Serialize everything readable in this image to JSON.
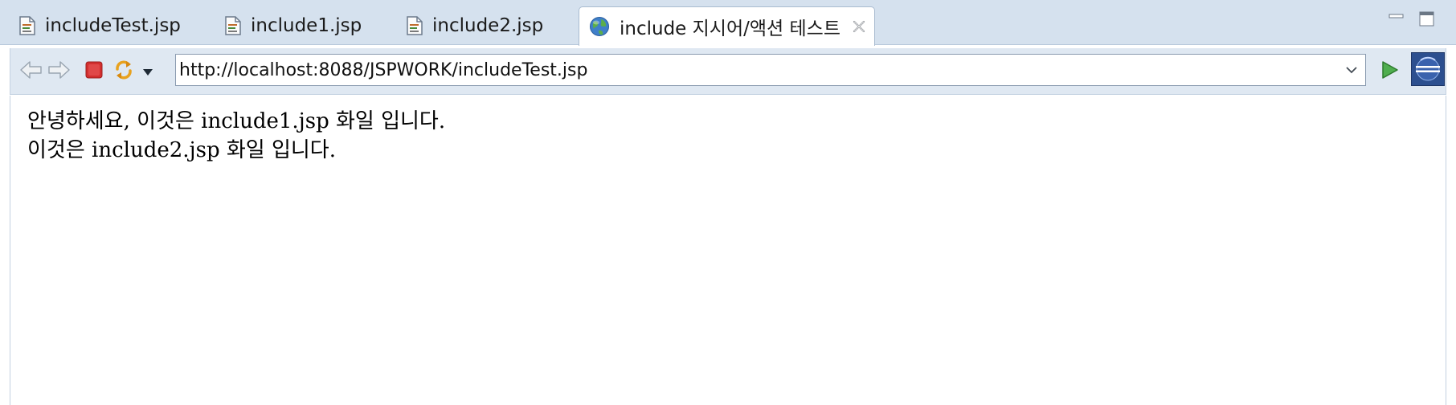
{
  "tabs": [
    {
      "label": "includeTest.jsp",
      "icon": "jsp-file-icon"
    },
    {
      "label": "include1.jsp",
      "icon": "jsp-file-icon"
    },
    {
      "label": "include2.jsp",
      "icon": "jsp-file-icon"
    },
    {
      "label": "include 지시어/액션 테스트",
      "icon": "globe-icon",
      "active": true
    }
  ],
  "window_controls": {
    "minimize_icon": "minimize-icon",
    "maximize_icon": "maximize-icon"
  },
  "toolbar": {
    "back_icon": "back-arrow-icon",
    "forward_icon": "forward-arrow-icon",
    "stop_icon": "stop-icon",
    "refresh_icon": "refresh-icon",
    "refresh_menu_icon": "chevron-down-icon",
    "go_icon": "play-go-icon",
    "browser_icon": "eclipse-browser-icon"
  },
  "address_bar": {
    "url": "http://localhost:8088/JSPWORK/includeTest.jsp"
  },
  "page": {
    "lines": [
      "안녕하세요, 이것은 include1.jsp 화일 입니다.",
      "이것은 include2.jsp 화일 입니다."
    ]
  },
  "colors": {
    "tabbar_bg": "#d5e1ee",
    "toolbar_bg": "#dfe8f2",
    "stop_red": "#d32f2f",
    "go_green": "#3a9a3a"
  }
}
